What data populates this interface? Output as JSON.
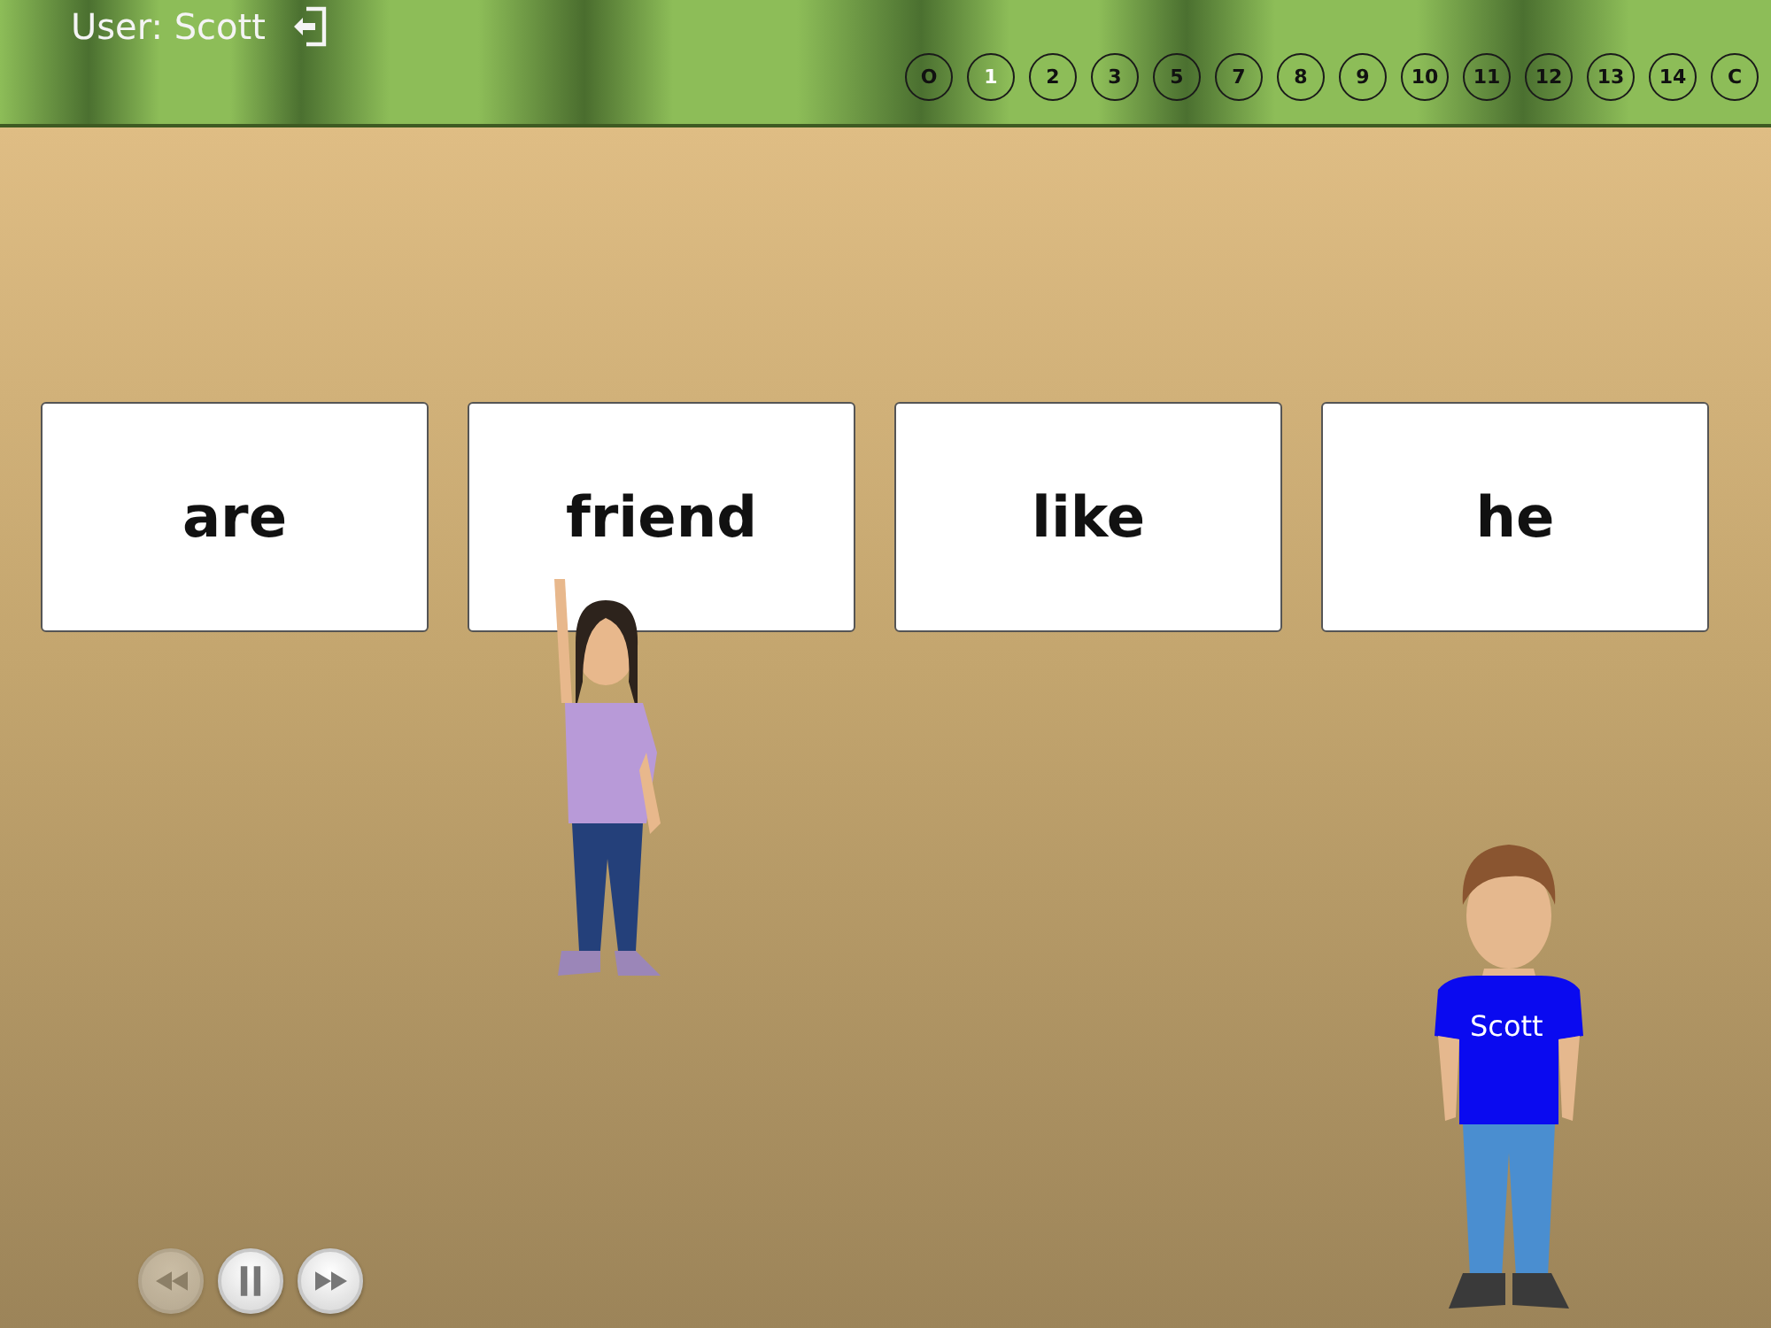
{
  "user": {
    "label": "User: Scott"
  },
  "levels": [
    {
      "label": "O",
      "selected": false
    },
    {
      "label": "1",
      "selected": true
    },
    {
      "label": "2",
      "selected": false
    },
    {
      "label": "3",
      "selected": false
    },
    {
      "label": "5",
      "selected": false
    },
    {
      "label": "7",
      "selected": false
    },
    {
      "label": "8",
      "selected": false
    },
    {
      "label": "9",
      "selected": false
    },
    {
      "label": "10",
      "selected": false
    },
    {
      "label": "11",
      "selected": false
    },
    {
      "label": "12",
      "selected": false
    },
    {
      "label": "13",
      "selected": false
    },
    {
      "label": "14",
      "selected": false
    },
    {
      "label": "C",
      "selected": false
    }
  ],
  "cards": [
    "are",
    "friend",
    "like",
    "he"
  ],
  "characters": [
    {
      "kind": "girl"
    },
    {
      "kind": "boy",
      "shirt_text": "Scott"
    }
  ],
  "playback": [
    {
      "kind": "rewind",
      "disabled": true
    },
    {
      "kind": "pause",
      "disabled": false
    },
    {
      "kind": "forward",
      "disabled": false
    }
  ]
}
